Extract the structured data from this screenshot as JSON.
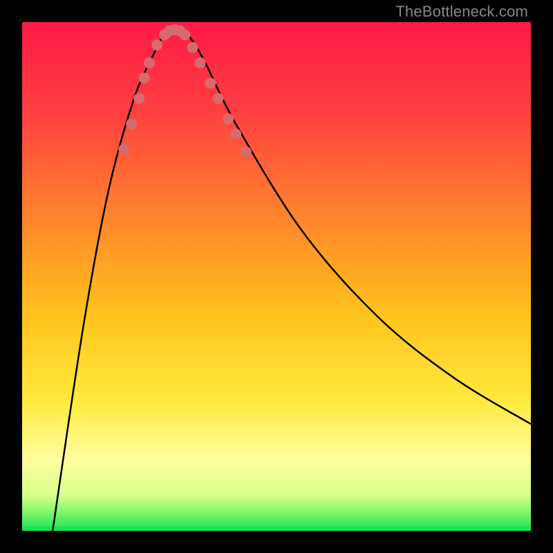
{
  "watermark": "TheBottleneck.com",
  "colors": {
    "frame": "#000000",
    "curve": "#000000",
    "markers": "#d76a6c",
    "green_band": "#18e257",
    "band_soft": "#fff9bb"
  },
  "chart_data": {
    "type": "line",
    "title": "",
    "xlabel": "",
    "ylabel": "",
    "xlim": [
      0,
      100
    ],
    "ylim": [
      0,
      100
    ],
    "grid": false,
    "legend": false,
    "gradient_stops": [
      {
        "pos": 0.0,
        "color": "#ff1a45"
      },
      {
        "pos": 0.18,
        "color": "#ff4040"
      },
      {
        "pos": 0.4,
        "color": "#ff8a2a"
      },
      {
        "pos": 0.58,
        "color": "#ffc41e"
      },
      {
        "pos": 0.74,
        "color": "#ffe93a"
      },
      {
        "pos": 0.86,
        "color": "#fffea0"
      },
      {
        "pos": 0.93,
        "color": "#d8ff8a"
      },
      {
        "pos": 0.965,
        "color": "#7cf56a"
      },
      {
        "pos": 1.0,
        "color": "#18e257"
      }
    ],
    "curve_control_points": [
      {
        "x": 6,
        "y": 0
      },
      {
        "x": 12,
        "y": 40
      },
      {
        "x": 17,
        "y": 67
      },
      {
        "x": 22,
        "y": 85
      },
      {
        "x": 26,
        "y": 94
      },
      {
        "x": 27.5,
        "y": 97
      },
      {
        "x": 29,
        "y": 98.5
      },
      {
        "x": 31,
        "y": 98.5
      },
      {
        "x": 33,
        "y": 97
      },
      {
        "x": 36,
        "y": 92
      },
      {
        "x": 42,
        "y": 80
      },
      {
        "x": 55,
        "y": 59
      },
      {
        "x": 70,
        "y": 42
      },
      {
        "x": 85,
        "y": 30
      },
      {
        "x": 100,
        "y": 21
      }
    ],
    "markers": [
      {
        "x": 20.0,
        "y": 75.0
      },
      {
        "x": 21.5,
        "y": 80.0
      },
      {
        "x": 23.0,
        "y": 85.0
      },
      {
        "x": 24.0,
        "y": 89.0
      },
      {
        "x": 25.0,
        "y": 92.0
      },
      {
        "x": 26.5,
        "y": 95.5
      },
      {
        "x": 28.0,
        "y": 97.5
      },
      {
        "x": 29.0,
        "y": 98.3
      },
      {
        "x": 30.0,
        "y": 98.5
      },
      {
        "x": 31.0,
        "y": 98.3
      },
      {
        "x": 32.0,
        "y": 97.5
      },
      {
        "x": 33.5,
        "y": 95.0
      },
      {
        "x": 35.0,
        "y": 92.0
      },
      {
        "x": 37.0,
        "y": 88.0
      },
      {
        "x": 38.5,
        "y": 85.0
      },
      {
        "x": 40.5,
        "y": 81.0
      },
      {
        "x": 42.0,
        "y": 78.0
      },
      {
        "x": 44.0,
        "y": 74.5
      }
    ],
    "marker_radius": 8
  }
}
